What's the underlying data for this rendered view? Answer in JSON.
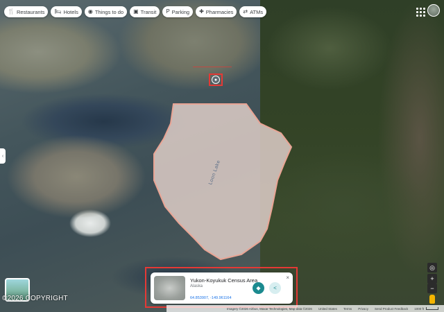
{
  "chips": [
    {
      "icon": "fork-knife-icon",
      "glyph": "🍴",
      "label": "Restaurants"
    },
    {
      "icon": "bed-icon",
      "glyph": "🛏",
      "label": "Hotels"
    },
    {
      "icon": "camera-icon",
      "glyph": "◉",
      "label": "Things to do"
    },
    {
      "icon": "bus-icon",
      "glyph": "▣",
      "label": "Transit"
    },
    {
      "icon": "parking-icon",
      "glyph": "P",
      "label": "Parking"
    },
    {
      "icon": "pharmacy-icon",
      "glyph": "✚",
      "label": "Pharmacies"
    },
    {
      "icon": "atm-icon",
      "glyph": "⇄",
      "label": "ATMs"
    }
  ],
  "map": {
    "lake_label": "Loon Lake",
    "colors": {
      "lake_fill": "#d9c9c4",
      "lake_outline": "#e9a494",
      "highlight": "#e53935"
    }
  },
  "card": {
    "title": "Yukon-Koyukuk Census Area",
    "subtitle": "Alaska",
    "coords": "64.853907, -149.961164",
    "close_glyph": "×",
    "directions_glyph": "◆",
    "share_glyph": "<"
  },
  "controls": {
    "locate_glyph": "◎",
    "zoom_in": "+",
    "zoom_out": "−"
  },
  "watermark": "©2026 COPYRIGHT",
  "attribution": {
    "imagery": "Imagery ©2026 Airbus, Maxar Technologies, Map data ©2026",
    "country": "United States",
    "terms": "Terms",
    "privacy": "Privacy",
    "feedback": "Send Product Feedback",
    "scale": "1000 ft"
  }
}
